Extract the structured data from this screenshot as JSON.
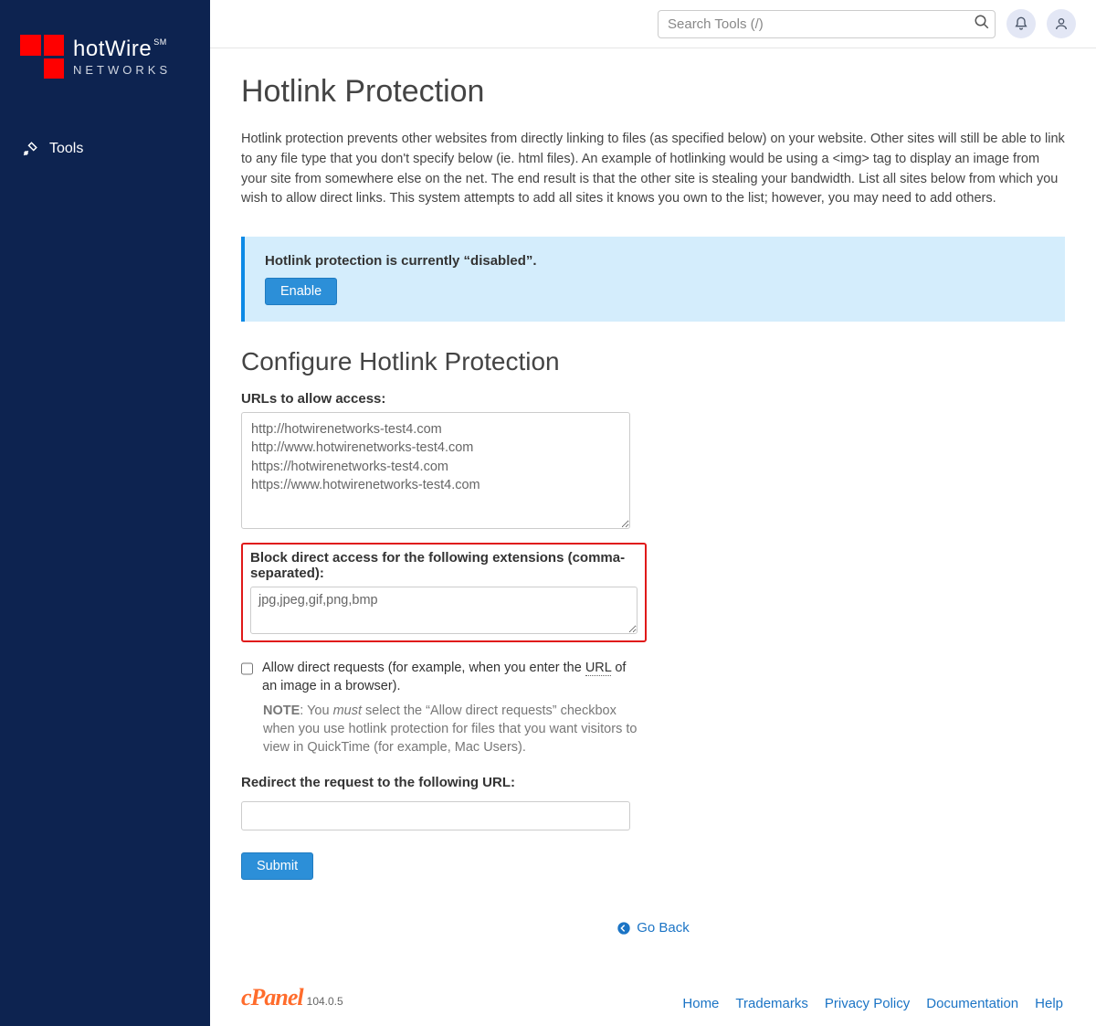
{
  "brand": {
    "name": "hotWire",
    "sm": "SM",
    "sub": "NETWORKS"
  },
  "sidebar": {
    "items": [
      {
        "label": "Tools"
      }
    ]
  },
  "topbar": {
    "search_placeholder": "Search Tools (/)"
  },
  "page": {
    "title": "Hotlink Protection",
    "desc": "Hotlink protection prevents other websites from directly linking to files (as specified below) on your website. Other sites will still be able to link to any file type that you don't specify below (ie. html files). An example of hotlinking would be using a <img> tag to display an image from your site from somewhere else on the net. The end result is that the other site is stealing your bandwidth. List all sites below from which you wish to allow direct links. This system attempts to add all sites it knows you own to the list; however, you may need to add others."
  },
  "alert": {
    "status_text": "Hotlink protection is currently “disabled”.",
    "enable_label": "Enable"
  },
  "configure": {
    "heading": "Configure Hotlink Protection",
    "urls_label": "URLs to allow access:",
    "urls_value": "http://hotwirenetworks-test4.com\nhttp://www.hotwirenetworks-test4.com\nhttps://hotwirenetworks-test4.com\nhttps://www.hotwirenetworks-test4.com",
    "ext_label": "Block direct access for the following extensions (comma-separated):",
    "ext_value": "jpg,jpeg,gif,png,bmp",
    "checkbox_text_pre": "Allow direct requests (for example, when you enter the ",
    "checkbox_url_abbr": "URL",
    "checkbox_text_post": " of an image in a browser).",
    "note_bold": "NOTE",
    "note_text_pre": ": You ",
    "note_must": "must",
    "note_text_post": " select the “Allow direct requests” checkbox when you use hotlink protection for files that you want visitors to view in QuickTime (for example, Mac Users).",
    "redirect_label": "Redirect the request to the following URL:",
    "redirect_value": "",
    "submit_label": "Submit"
  },
  "goback_label": "Go Back",
  "footer": {
    "cpanel": "cPanel",
    "version": "104.0.5",
    "links": [
      "Home",
      "Trademarks",
      "Privacy Policy",
      "Documentation",
      "Help"
    ]
  }
}
